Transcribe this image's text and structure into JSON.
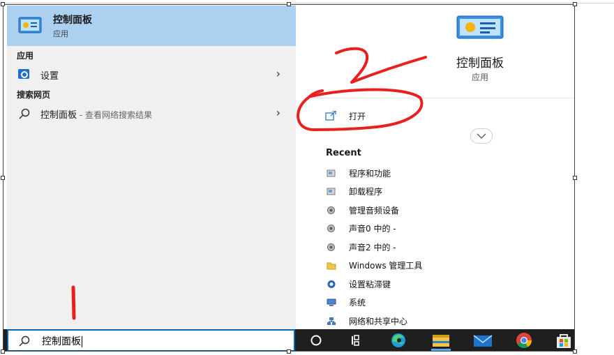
{
  "best_match": {
    "title": "控制面板",
    "subtitle": "应用"
  },
  "sections": {
    "apps_header": "应用",
    "web_header": "搜索网页"
  },
  "app_results": [
    {
      "label": "设置",
      "icon": "gear-icon"
    }
  ],
  "web_results": [
    {
      "label": "控制面板",
      "hint": " - 查看网络搜索结果",
      "icon": "search-icon"
    }
  ],
  "detail": {
    "name": "控制面板",
    "type": "应用",
    "open_label": "打开",
    "recent_header": "Recent",
    "recent_items": [
      {
        "label": "程序和功能",
        "icon": "programs-icon"
      },
      {
        "label": "卸载程序",
        "icon": "programs-icon"
      },
      {
        "label": "管理音频设备",
        "icon": "speaker-icon"
      },
      {
        "label": "声音0 中的 -",
        "icon": "speaker-icon"
      },
      {
        "label": "声音2 中的 -",
        "icon": "speaker-icon"
      },
      {
        "label": "Windows 管理工具",
        "icon": "folder-icon"
      },
      {
        "label": "设置粘滞键",
        "icon": "ease-of-access-icon"
      },
      {
        "label": "系统",
        "icon": "system-icon"
      },
      {
        "label": "网络和共享中心",
        "icon": "network-icon"
      }
    ]
  },
  "search_box": {
    "value": "控制面板"
  },
  "taskbar_icons": [
    "task-view-circle-icon",
    "task-view-icon",
    "edge-icon",
    "file-explorer-icon",
    "mail-icon",
    "chrome-icon",
    "store-icon"
  ],
  "annotations": {
    "mark_1": "1",
    "mark_2": "2"
  },
  "colors": {
    "accent": "#0a64b4",
    "highlight": "#acd0ef",
    "annotation": "#e8201e",
    "taskbar": "#1f1f1f"
  }
}
